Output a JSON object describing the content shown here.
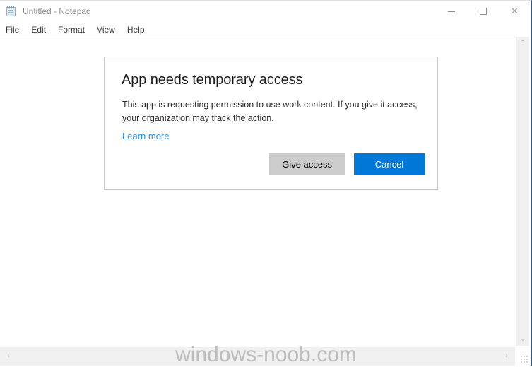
{
  "window": {
    "title": "Untitled - Notepad",
    "icon": "notepad-icon",
    "caption": {
      "minimize_label": "Minimize",
      "maximize_label": "Maximize",
      "close_label": "Close",
      "close_glyph": "✕"
    }
  },
  "menu": {
    "items": [
      {
        "label": "File"
      },
      {
        "label": "Edit"
      },
      {
        "label": "Format"
      },
      {
        "label": "View"
      },
      {
        "label": "Help"
      }
    ]
  },
  "editor": {
    "content": ""
  },
  "scrollbars": {
    "vertical": {
      "up_glyph": "⌃",
      "down_glyph": "⌄"
    },
    "horizontal": {
      "left_glyph": "‹",
      "right_glyph": "›"
    }
  },
  "dialog": {
    "title": "App needs temporary access",
    "body": "This app is requesting permission to use work content. If you give it access, your organization may track the action.",
    "link_label": "Learn more",
    "primary_button": "Cancel",
    "secondary_button": "Give access",
    "accent_color": "#0078d7",
    "secondary_color": "#cccccc"
  },
  "watermark": {
    "text": "windows-noob.com"
  }
}
